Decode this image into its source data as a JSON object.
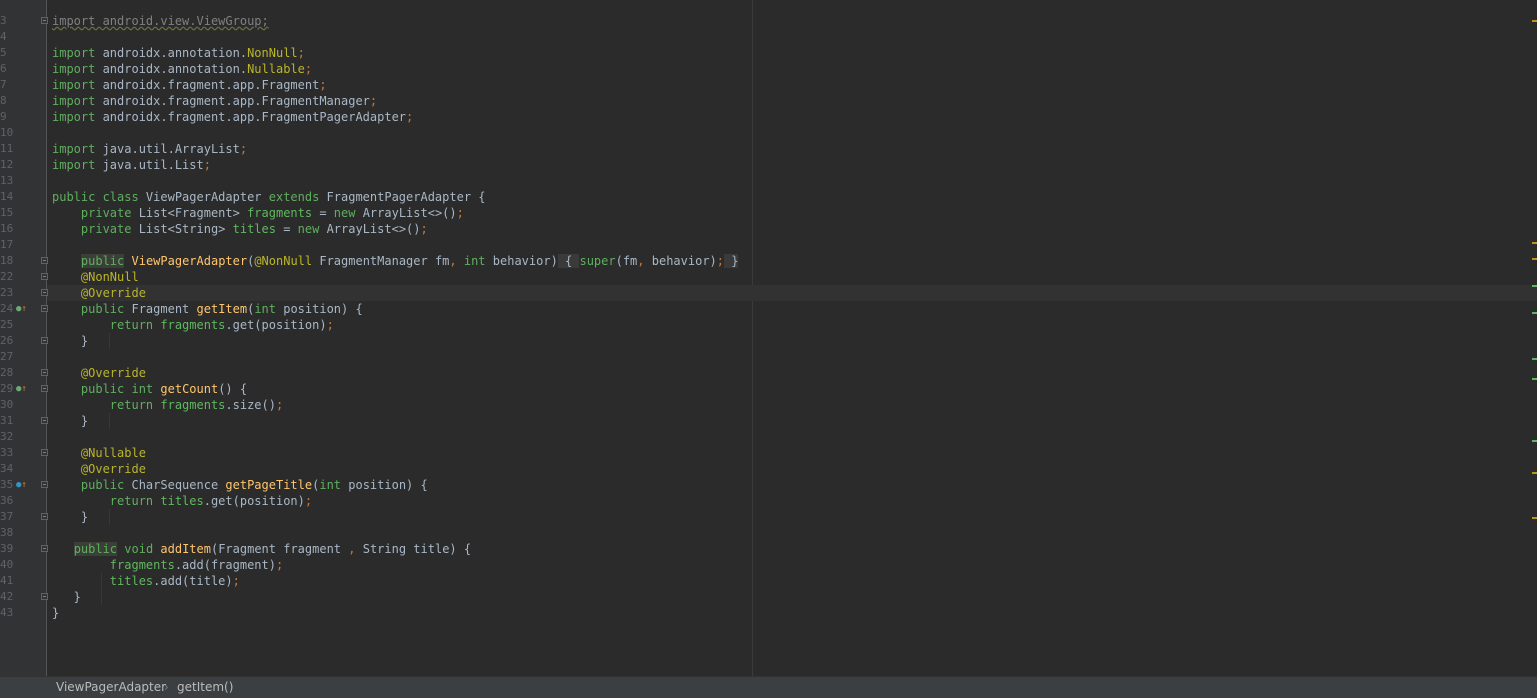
{
  "editor": {
    "caret_line": "23",
    "lines": [
      {
        "no": "3",
        "fold": true,
        "parts": [
          [
            "fade",
            "import android.view.ViewGroup;"
          ]
        ]
      },
      {
        "no": "4",
        "parts": []
      },
      {
        "no": "5",
        "parts": [
          [
            "kw2",
            "import "
          ],
          [
            "",
            "androidx.annotation."
          ],
          [
            "ann",
            "NonNull"
          ],
          [
            "kw",
            ";"
          ]
        ]
      },
      {
        "no": "6",
        "parts": [
          [
            "kw2",
            "import "
          ],
          [
            "",
            "androidx.annotation."
          ],
          [
            "ann",
            "Nullable"
          ],
          [
            "kw",
            ";"
          ]
        ]
      },
      {
        "no": "7",
        "parts": [
          [
            "kw2",
            "import "
          ],
          [
            "",
            "androidx.fragment.app.Fragment"
          ],
          [
            "kw",
            ";"
          ]
        ]
      },
      {
        "no": "8",
        "parts": [
          [
            "kw2",
            "import "
          ],
          [
            "",
            "androidx.fragment.app.FragmentManager"
          ],
          [
            "kw",
            ";"
          ]
        ]
      },
      {
        "no": "9",
        "parts": [
          [
            "kw2",
            "import "
          ],
          [
            "",
            "androidx.fragment.app.FragmentPagerAdapter"
          ],
          [
            "kw",
            ";"
          ]
        ]
      },
      {
        "no": "10",
        "parts": []
      },
      {
        "no": "11",
        "parts": [
          [
            "kw2",
            "import "
          ],
          [
            "",
            "java.util.ArrayList"
          ],
          [
            "kw",
            ";"
          ]
        ]
      },
      {
        "no": "12",
        "parts": [
          [
            "kw2",
            "import "
          ],
          [
            "",
            "java.util.List"
          ],
          [
            "kw",
            ";"
          ]
        ]
      },
      {
        "no": "13",
        "parts": []
      },
      {
        "no": "14",
        "parts": [
          [
            "kw2",
            "public class "
          ],
          [
            "",
            "ViewPagerAdapter "
          ],
          [
            "kw2",
            "extends "
          ],
          [
            "",
            "FragmentPagerAdapter {"
          ]
        ]
      },
      {
        "no": "15",
        "parts": [
          [
            "",
            "    "
          ],
          [
            "kw2",
            "private "
          ],
          [
            "",
            "List<Fragment> "
          ],
          [
            "fld",
            "fragments"
          ],
          [
            "",
            " = "
          ],
          [
            "kw2",
            "new "
          ],
          [
            "",
            "ArrayList<>()"
          ],
          [
            "kw",
            ";"
          ]
        ]
      },
      {
        "no": "16",
        "parts": [
          [
            "",
            "    "
          ],
          [
            "kw2",
            "private "
          ],
          [
            "",
            "List<String> "
          ],
          [
            "fld",
            "titles"
          ],
          [
            "",
            " = "
          ],
          [
            "kw2",
            "new "
          ],
          [
            "",
            "ArrayList<>()"
          ],
          [
            "kw",
            ";"
          ]
        ]
      },
      {
        "no": "17",
        "parts": []
      },
      {
        "no": "18",
        "fold": true,
        "parts": [
          [
            "",
            "    "
          ],
          [
            "hl kw2",
            "public"
          ],
          [
            "",
            " "
          ],
          [
            "fn",
            "ViewPagerAdapter"
          ],
          [
            "",
            "("
          ],
          [
            "ann",
            "@NonNull "
          ],
          [
            "",
            "FragmentManager fm"
          ],
          [
            "kw",
            ", "
          ],
          [
            "kw2",
            "int "
          ],
          [
            "",
            "behavior)"
          ],
          [
            "foldbox",
            " { "
          ],
          [
            "kw2",
            "super"
          ],
          [
            "",
            "(fm"
          ],
          [
            "kw",
            ", "
          ],
          [
            "",
            "behavior)"
          ],
          [
            "kw",
            ";"
          ],
          [
            "foldbox",
            " }"
          ]
        ]
      },
      {
        "no": "22",
        "fold": true,
        "parts": [
          [
            "",
            "    "
          ],
          [
            "ann",
            "@NonNull"
          ]
        ]
      },
      {
        "no": "23",
        "fold": true,
        "parts": [
          [
            "",
            "    "
          ],
          [
            "ann",
            "@Override"
          ]
        ]
      },
      {
        "no": "24",
        "fold": true,
        "marker": "impl",
        "parts": [
          [
            "",
            "    "
          ],
          [
            "kw2",
            "public "
          ],
          [
            "",
            "Fragment "
          ],
          [
            "fn",
            "getItem"
          ],
          [
            "",
            "("
          ],
          [
            "kw2",
            "int "
          ],
          [
            "",
            "position) {"
          ]
        ]
      },
      {
        "no": "25",
        "parts": [
          [
            "",
            "        "
          ],
          [
            "kw2",
            "return "
          ],
          [
            "fld",
            "fragments"
          ],
          [
            "",
            ".get(position)"
          ],
          [
            "kw",
            ";"
          ]
        ]
      },
      {
        "no": "26",
        "fold": true,
        "parts": [
          [
            "",
            "    }"
          ]
        ]
      },
      {
        "no": "27",
        "parts": []
      },
      {
        "no": "28",
        "fold": true,
        "parts": [
          [
            "",
            "    "
          ],
          [
            "ann",
            "@Override"
          ]
        ]
      },
      {
        "no": "29",
        "fold": true,
        "marker": "impl",
        "parts": [
          [
            "",
            "    "
          ],
          [
            "kw2",
            "public int "
          ],
          [
            "fn",
            "getCount"
          ],
          [
            "",
            "() {"
          ]
        ]
      },
      {
        "no": "30",
        "parts": [
          [
            "",
            "        "
          ],
          [
            "kw2",
            "return "
          ],
          [
            "fld",
            "fragments"
          ],
          [
            "",
            ".size()"
          ],
          [
            "kw",
            ";"
          ]
        ]
      },
      {
        "no": "31",
        "fold": true,
        "parts": [
          [
            "",
            "    }"
          ]
        ]
      },
      {
        "no": "32",
        "parts": []
      },
      {
        "no": "33",
        "fold": true,
        "parts": [
          [
            "",
            "    "
          ],
          [
            "ann",
            "@Nullable"
          ]
        ]
      },
      {
        "no": "34",
        "parts": [
          [
            "",
            "    "
          ],
          [
            "ann",
            "@Override"
          ]
        ]
      },
      {
        "no": "35",
        "fold": true,
        "marker": "override",
        "parts": [
          [
            "",
            "    "
          ],
          [
            "kw2",
            "public "
          ],
          [
            "",
            "CharSequence "
          ],
          [
            "fn",
            "getPageTitle"
          ],
          [
            "",
            "("
          ],
          [
            "kw2",
            "int "
          ],
          [
            "",
            "position) {"
          ]
        ]
      },
      {
        "no": "36",
        "parts": [
          [
            "",
            "        "
          ],
          [
            "kw2",
            "return "
          ],
          [
            "fld",
            "titles"
          ],
          [
            "",
            ".get(position)"
          ],
          [
            "kw",
            ";"
          ]
        ]
      },
      {
        "no": "37",
        "fold": true,
        "parts": [
          [
            "",
            "    }"
          ]
        ]
      },
      {
        "no": "38",
        "parts": []
      },
      {
        "no": "39",
        "fold": true,
        "parts": [
          [
            "",
            "   "
          ],
          [
            "hl kw2",
            "public"
          ],
          [
            "",
            " "
          ],
          [
            "kw2",
            "void "
          ],
          [
            "fn",
            "addItem"
          ],
          [
            "",
            "(Fragment fragment "
          ],
          [
            "kw",
            ", "
          ],
          [
            "",
            "String title) {"
          ]
        ]
      },
      {
        "no": "40",
        "parts": [
          [
            "",
            "        "
          ],
          [
            "fld",
            "fragments"
          ],
          [
            "",
            ".add(fragment)"
          ],
          [
            "kw",
            ";"
          ]
        ]
      },
      {
        "no": "41",
        "parts": [
          [
            "",
            "        "
          ],
          [
            "fld",
            "titles"
          ],
          [
            "",
            ".add(title)"
          ],
          [
            "kw",
            ";"
          ]
        ]
      },
      {
        "no": "42",
        "fold": true,
        "parts": [
          [
            "",
            "   }"
          ]
        ]
      },
      {
        "no": "43",
        "parts": [
          [
            "",
            "}"
          ]
        ]
      }
    ]
  },
  "statusbar": {
    "crumbs": [
      "ViewPagerAdapter",
      "getItem()"
    ]
  },
  "colors": {
    "background": "#2b2b2b",
    "keyword": "#cc7832",
    "annotation": "#bbb529",
    "method": "#ffc66d",
    "field": "#5fb85f"
  },
  "icons": {
    "impl": "implements-method-icon",
    "override": "overrides-method-icon"
  }
}
